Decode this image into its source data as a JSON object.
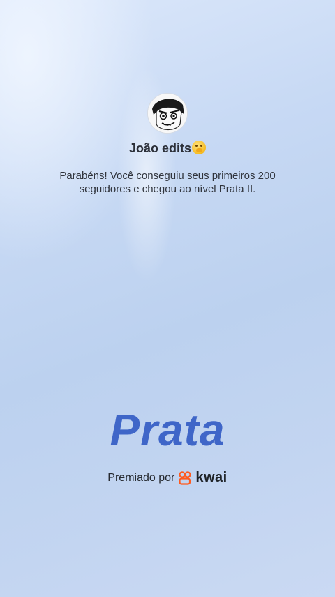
{
  "profile": {
    "name": "João edits",
    "avatar_icon": "sketch-face-avatar"
  },
  "congrats": {
    "message": "Parabéns! Você conseguiu seus primeiros 200 seguidores e chegou ao nível Prata II."
  },
  "badge": {
    "level_title": "Prata",
    "level_color": "#3f66c8"
  },
  "footer": {
    "awarded_by_label": "Premiado por",
    "brand_name": "kwai",
    "brand_color": "#ff5a1f",
    "brand_icon": "kwai-logo-icon"
  }
}
